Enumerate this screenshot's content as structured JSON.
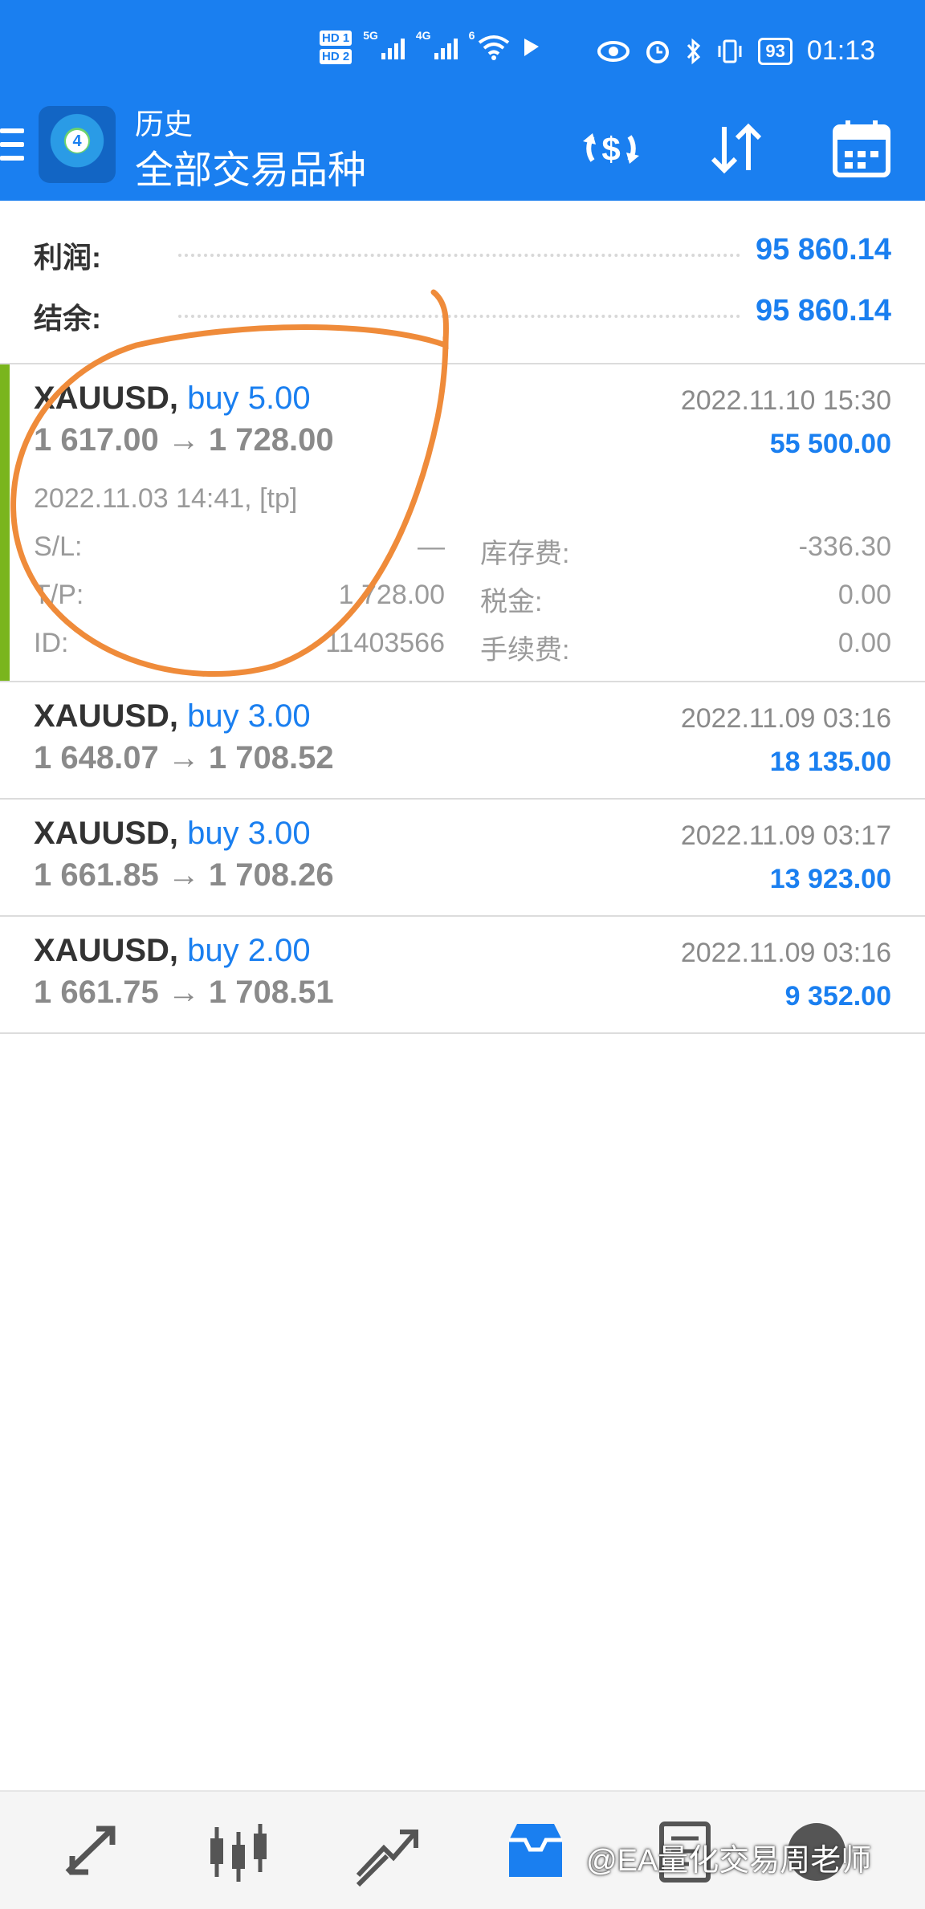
{
  "status_bar": {
    "hd1": "HD 1",
    "hd2": "HD 2",
    "net1": "5G",
    "net2": "4G",
    "net3": "6",
    "battery": "93",
    "time": "01:13"
  },
  "app_bar": {
    "title": "历史",
    "subtitle": "全部交易品种"
  },
  "summary": {
    "profit_label": "利润:",
    "profit_value": "95 860.14",
    "balance_label": "结余:",
    "balance_value": "95 860.14"
  },
  "deals": [
    {
      "symbol": "XAUUSD,",
      "side": "buy 5.00",
      "prices": "1 617.00 → 1 728.00",
      "close_time": "2022.11.10 15:30",
      "profit": "55 500.00",
      "open_time": "2022.11.03 14:41, [tp]",
      "sl_label": "S/L:",
      "sl_value": "—",
      "tp_label": "T/P:",
      "tp_value": "1 728.00",
      "id_label": "ID:",
      "id_value": "11403566",
      "swap_label": "库存费:",
      "swap_value": "-336.30",
      "tax_label": "税金:",
      "tax_value": "0.00",
      "fee_label": "手续费:",
      "fee_value": "0.00"
    },
    {
      "symbol": "XAUUSD,",
      "side": "buy 3.00",
      "prices": "1 648.07 → 1 708.52",
      "close_time": "2022.11.09 03:16",
      "profit": "18 135.00"
    },
    {
      "symbol": "XAUUSD,",
      "side": "buy 3.00",
      "prices": "1 661.85 → 1 708.26",
      "close_time": "2022.11.09 03:17",
      "profit": "13 923.00"
    },
    {
      "symbol": "XAUUSD,",
      "side": "buy 2.00",
      "prices": "1 661.75 → 1 708.51",
      "close_time": "2022.11.09 03:16",
      "profit": "9 352.00"
    }
  ],
  "bottom_nav": [
    "quotes-icon",
    "chart-icon",
    "trade-icon",
    "history-icon",
    "news-icon",
    "chat-icon"
  ],
  "watermark": "@EA量化交易周老师",
  "colors": {
    "primary": "#1a7ff0",
    "accent_bar": "#7ab51d",
    "annotation": "#ef8b3a"
  }
}
